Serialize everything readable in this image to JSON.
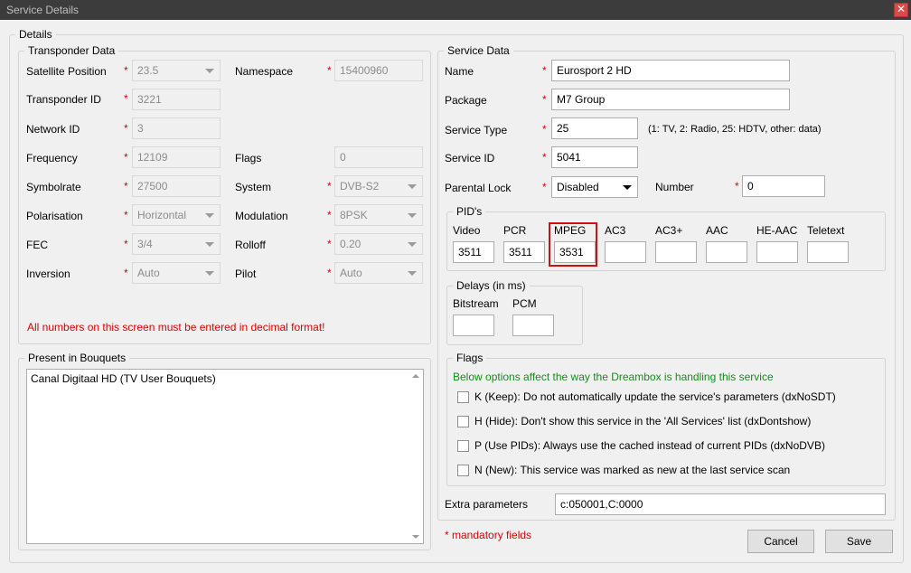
{
  "window": {
    "title": "Service Details",
    "close_glyph": "✕"
  },
  "details_legend": "Details",
  "transponder": {
    "legend": "Transponder Data",
    "satellite_position": {
      "label": "Satellite Position",
      "value": "23.5"
    },
    "namespace": {
      "label": "Namespace",
      "value": "15400960"
    },
    "transponder_id": {
      "label": "Transponder ID",
      "value": "3221"
    },
    "network_id": {
      "label": "Network ID",
      "value": "3"
    },
    "frequency": {
      "label": "Frequency",
      "value": "12109"
    },
    "flags": {
      "label": "Flags",
      "value": "0"
    },
    "symbolrate": {
      "label": "Symbolrate",
      "value": "27500"
    },
    "system": {
      "label": "System",
      "value": "DVB-S2"
    },
    "polarisation": {
      "label": "Polarisation",
      "value": "Horizontal"
    },
    "modulation": {
      "label": "Modulation",
      "value": "8PSK"
    },
    "fec": {
      "label": "FEC",
      "value": "3/4"
    },
    "rolloff": {
      "label": "Rolloff",
      "value": "0.20"
    },
    "inversion": {
      "label": "Inversion",
      "value": "Auto"
    },
    "pilot": {
      "label": "Pilot",
      "value": "Auto"
    },
    "warning": "All numbers on this screen must be entered in decimal format!"
  },
  "required_marker": "*",
  "bouquets": {
    "legend": "Present in Bouquets",
    "items": [
      "Canal Digitaal HD (TV User Bouquets)"
    ]
  },
  "service": {
    "legend": "Service Data",
    "name": {
      "label": "Name",
      "value": "Eurosport 2 HD"
    },
    "package": {
      "label": "Package",
      "value": "M7 Group"
    },
    "service_type": {
      "label": "Service Type",
      "value": "25",
      "hint": "(1: TV, 2: Radio, 25: HDTV, other: data)"
    },
    "service_id": {
      "label": "Service ID",
      "value": "5041"
    },
    "parental_lock": {
      "label": "Parental Lock",
      "value": "Disabled"
    },
    "number": {
      "label": "Number",
      "value": "0"
    }
  },
  "pids": {
    "legend": "PID's",
    "video": {
      "label": "Video",
      "value": "3511"
    },
    "pcr": {
      "label": "PCR",
      "value": "3511"
    },
    "mpeg": {
      "label": "MPEG",
      "value": "3531"
    },
    "ac3": {
      "label": "AC3",
      "value": ""
    },
    "ac3plus": {
      "label": "AC3+",
      "value": ""
    },
    "aac": {
      "label": "AAC",
      "value": ""
    },
    "heaac": {
      "label": "HE-AAC",
      "value": ""
    },
    "teletext": {
      "label": "Teletext",
      "value": ""
    }
  },
  "delays": {
    "legend": "Delays (in ms)",
    "bitstream": {
      "label": "Bitstream",
      "value": ""
    },
    "pcm": {
      "label": "PCM",
      "value": ""
    }
  },
  "flags": {
    "legend": "Flags",
    "note": "Below options affect the way the Dreambox is handling this service",
    "keep": "K (Keep): Do not automatically update the service's parameters (dxNoSDT)",
    "hide": "H (Hide): Don't show this service in the 'All Services' list (dxDontshow)",
    "use_pids": "P (Use PIDs): Always use the cached instead of current PIDs (dxNoDVB)",
    "new": "N (New): This service was marked as new at the last service scan"
  },
  "extra_parameters": {
    "label": "Extra parameters",
    "value": "c:050001,C:0000"
  },
  "mandatory_note": "* mandatory fields",
  "buttons": {
    "cancel": "Cancel",
    "save": "Save"
  },
  "colors": {
    "required": "#dd0000",
    "note_green": "#1a8a1a",
    "highlight": "#d01010"
  }
}
